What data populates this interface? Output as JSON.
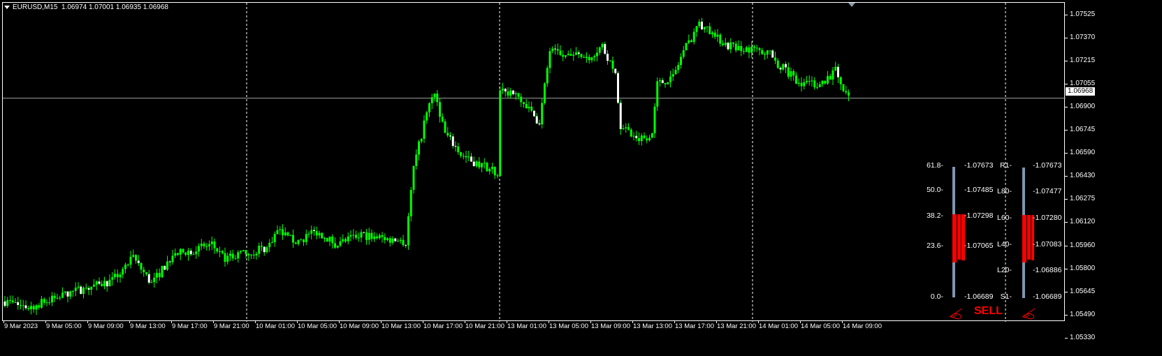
{
  "header": {
    "symbol": "EURUSD,M15",
    "ohlc": "1.06974 1.07001 1.06935 1.06968"
  },
  "price_axis": {
    "labels": [
      "1.07525",
      "1.07370",
      "1.07215",
      "1.07055",
      "1.06900",
      "1.06745",
      "1.06590",
      "1.06430",
      "1.06275",
      "1.06120",
      "1.05960",
      "1.05800",
      "1.05645",
      "1.05490",
      "1.05330"
    ],
    "current": "1.06968",
    "current_value": 1.06968
  },
  "time_axis": {
    "labels": [
      "9 Mar 2023",
      "9 Mar 05:00",
      "9 Mar 09:00",
      "9 Mar 13:00",
      "9 Mar 17:00",
      "9 Mar 21:00",
      "10 Mar 01:00",
      "10 Mar 05:00",
      "10 Mar 09:00",
      "10 Mar 13:00",
      "10 Mar 17:00",
      "10 Mar 21:00",
      "13 Mar 01:00",
      "13 Mar 05:00",
      "13 Mar 09:00",
      "13 Mar 13:00",
      "13 Mar 17:00",
      "13 Mar 21:00",
      "14 Mar 01:00",
      "14 Mar 05:00",
      "14 Mar 09:00"
    ]
  },
  "chart_data": {
    "type": "candlestick",
    "bars_per_label": 16,
    "close_path": [
      [
        0,
        1.056
      ],
      [
        9,
        1.0556
      ],
      [
        25,
        1.0566
      ],
      [
        41,
        1.0574
      ],
      [
        49,
        1.0589
      ],
      [
        56,
        1.0572
      ],
      [
        64,
        1.0591
      ],
      [
        79,
        1.0598
      ],
      [
        84,
        1.0589
      ],
      [
        93,
        1.0593
      ],
      [
        100,
        1.0596
      ],
      [
        104,
        1.0607
      ],
      [
        111,
        1.06
      ],
      [
        119,
        1.0607
      ],
      [
        127,
        1.0598
      ],
      [
        135,
        1.0605
      ],
      [
        143,
        1.0603
      ],
      [
        153,
        1.06
      ],
      [
        156,
        1.065
      ],
      [
        161,
        1.0687
      ],
      [
        164,
        1.0701
      ],
      [
        168,
        1.0673
      ],
      [
        175,
        1.0657
      ],
      [
        188,
        1.0647
      ],
      [
        189,
        1.0701
      ],
      [
        197,
        1.0697
      ],
      [
        204,
        1.068
      ],
      [
        208,
        1.0729
      ],
      [
        212,
        1.0725
      ],
      [
        223,
        1.0725
      ],
      [
        228,
        1.0732
      ],
      [
        233,
        1.0711
      ],
      [
        235,
        1.0678
      ],
      [
        241,
        1.0668
      ],
      [
        247,
        1.0673
      ],
      [
        249,
        1.0706
      ],
      [
        255,
        1.0711
      ],
      [
        259,
        1.0729
      ],
      [
        265,
        1.0746
      ],
      [
        271,
        1.0739
      ],
      [
        276,
        1.0732
      ],
      [
        287,
        1.0729
      ],
      [
        292,
        1.0727
      ],
      [
        295,
        1.072
      ],
      [
        303,
        1.0708
      ],
      [
        311,
        1.0706
      ],
      [
        317,
        1.0715
      ],
      [
        319,
        1.0704
      ],
      [
        322,
        1.06968
      ]
    ],
    "colors": {
      "bull": "#00ff00",
      "bear": "#ffffff",
      "grid": "#ffffff"
    }
  },
  "indicator": {
    "fib": {
      "levels": [
        "61.8-",
        "50.0-",
        "38.2-",
        "23.6-",
        "0.0-"
      ],
      "prices": [
        "-1.07673",
        "-1.07485",
        "-1.07298",
        "-1.07065",
        "-1.06689"
      ]
    },
    "pivot": {
      "levels": [
        "R1-",
        "L80-",
        "L60-",
        "L40-",
        "L20-",
        "S1-"
      ],
      "prices": [
        "-1.07673",
        "-1.07477",
        "-1.07280",
        "-1.07083",
        "-1.06886",
        "-1.06689"
      ]
    },
    "signal": "SELL",
    "colors": {
      "bar": "#7f94b0",
      "signal": "#ff0000"
    }
  }
}
